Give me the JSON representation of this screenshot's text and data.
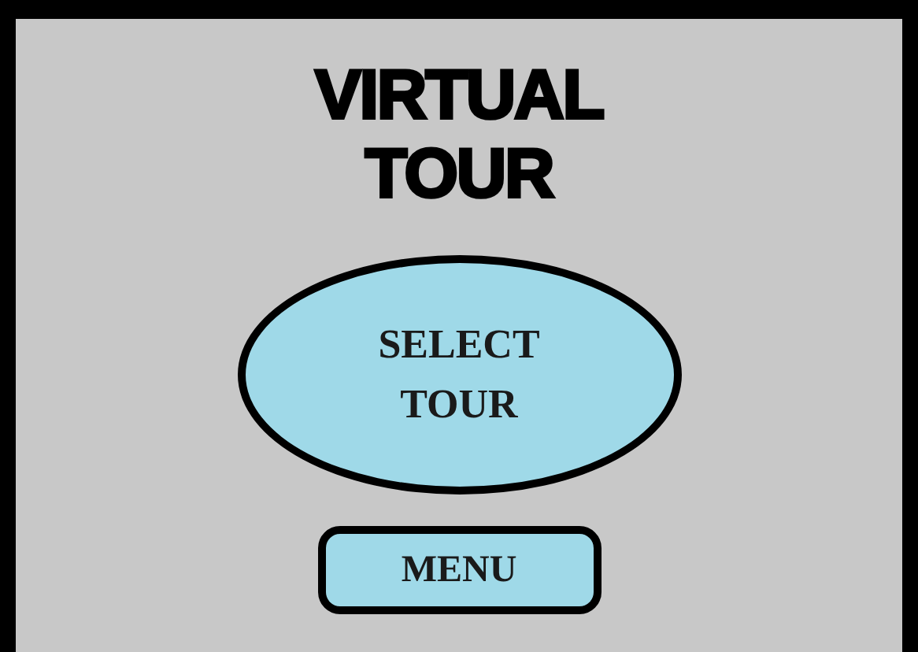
{
  "title": "VIRTUAL TOUR",
  "buttons": [
    {
      "kind": "oval",
      "label": "SELECT TOUR"
    },
    {
      "kind": "rounded",
      "label": "MENU"
    }
  ]
}
